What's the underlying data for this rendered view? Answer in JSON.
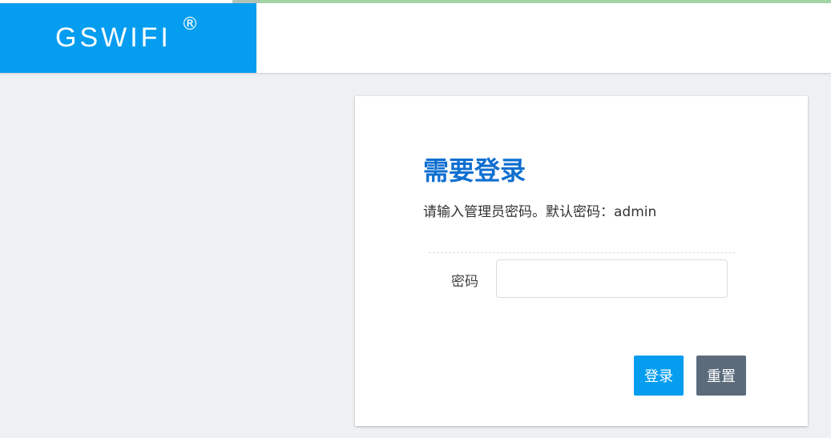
{
  "header": {
    "brand": "GSWIFI",
    "brand_mark": "®"
  },
  "login": {
    "title": "需要登录",
    "description": "请输入管理员密码。默认密码：admin",
    "password_label": "密码",
    "password_value": "",
    "login_button": "登录",
    "reset_button": "重置"
  },
  "colors": {
    "brand_bg": "#049def",
    "title": "#0f6fd0",
    "login_button": "#049def",
    "reset_button": "#5b6b7c",
    "page_bg": "#eef1f3"
  }
}
